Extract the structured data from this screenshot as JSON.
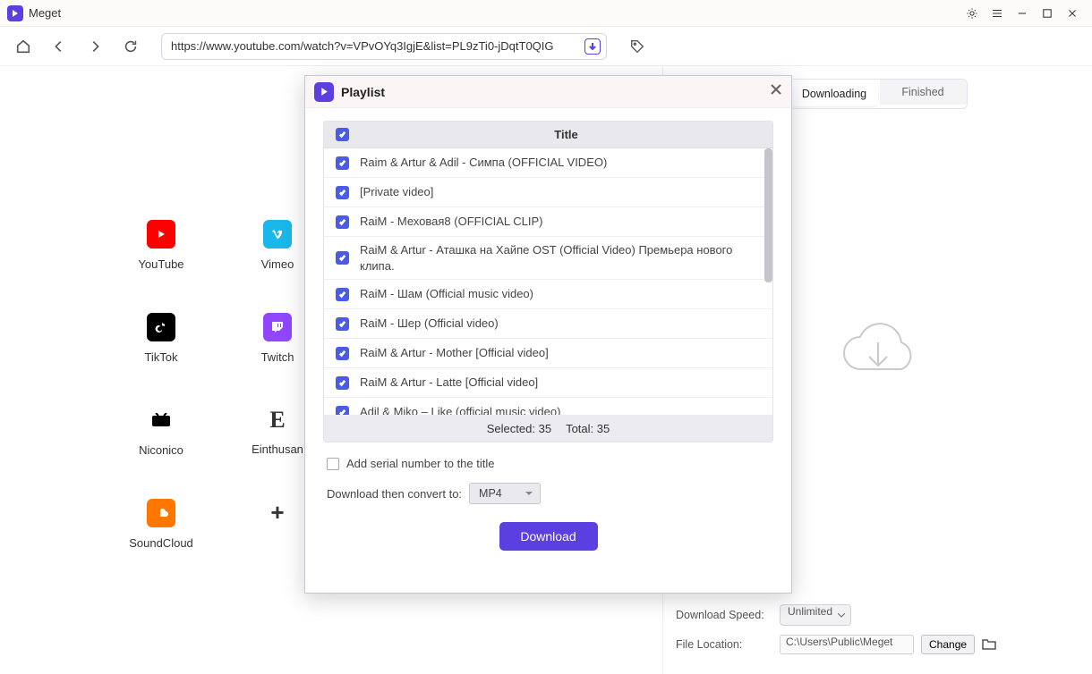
{
  "app": {
    "name": "Meget"
  },
  "url": "https://www.youtube.com/watch?v=VPvOYq3IgjE&list=PL9zTi0-jDqtT0QIG",
  "sites": {
    "youtube": "YouTube",
    "vimeo": "Vimeo",
    "tiktok": "TikTok",
    "twitch": "Twitch",
    "niconico": "Niconico",
    "einthusan": "Einthusan",
    "soundcloud": "SoundCloud"
  },
  "rightTabs": {
    "downloading": "Downloading",
    "finished": "Finished"
  },
  "settings": {
    "speedLabel": "Download Speed:",
    "speedValue": "Unlimited",
    "locationLabel": "File Location:",
    "locationValue": "C:\\Users\\Public\\Meget",
    "change": "Change"
  },
  "modal": {
    "title": "Playlist",
    "titleHeader": "Title",
    "summary": {
      "selectedLabel": "Selected:",
      "selectedCount": "35",
      "totalLabel": "Total:",
      "totalCount": "35"
    },
    "items": [
      "Raim & Artur & Adil - Симпа (OFFICIAL VIDEO)",
      "[Private video]",
      "RaiM - Меховая8 (OFFICIAL CLIP)",
      "RaiM & Artur - Аташка на Хайпе OST (Official Video) Премьера нового клипа.",
      "RaiM - Шам (Official music video)",
      "RaiM - Шер (Official video)",
      "RaiM & Artur - Mother [Official video]",
      "RaiM & Artur - Latte [Official video]",
      "Adil & Miko – Like (official music video)"
    ],
    "serialOpt": "Add serial number to the title",
    "convertLabel": "Download then convert to:",
    "convertFormat": "MP4",
    "downloadBtn": "Download"
  }
}
